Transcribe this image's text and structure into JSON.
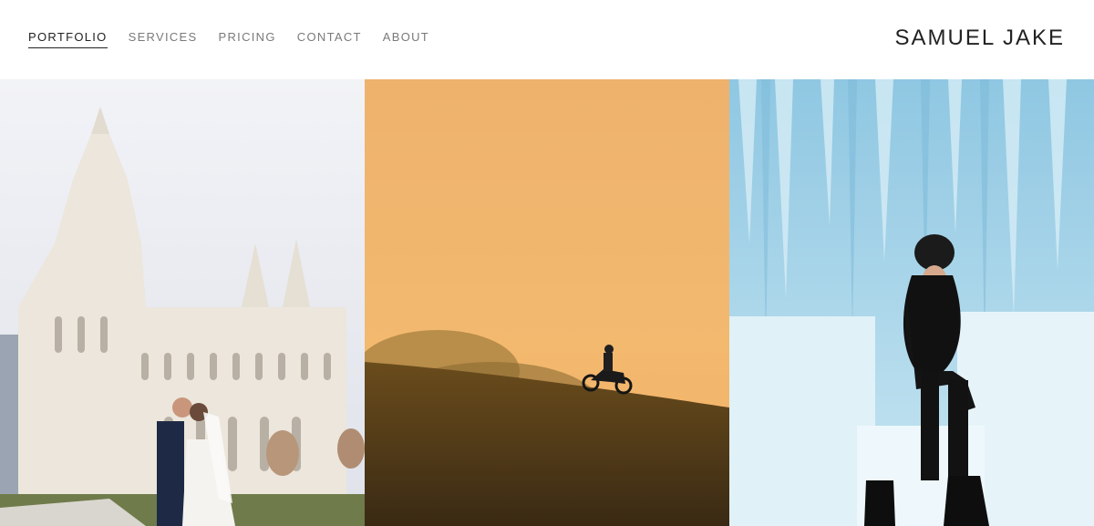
{
  "nav": {
    "items": [
      {
        "label": "PORTFOLIO",
        "active": true
      },
      {
        "label": "SERVICES",
        "active": false
      },
      {
        "label": "PRICING",
        "active": false
      },
      {
        "label": "CONTACT",
        "active": false
      },
      {
        "label": "ABOUT",
        "active": false
      }
    ]
  },
  "brand": {
    "name": "SAMUEL JAKE"
  },
  "colors": {
    "text_active": "#222222",
    "text_muted": "#7a7a7a",
    "photo_temple_sky": "#e4e6ec",
    "photo_desert_sky": "#f0b46a",
    "photo_ice": "#a9d6ea"
  }
}
